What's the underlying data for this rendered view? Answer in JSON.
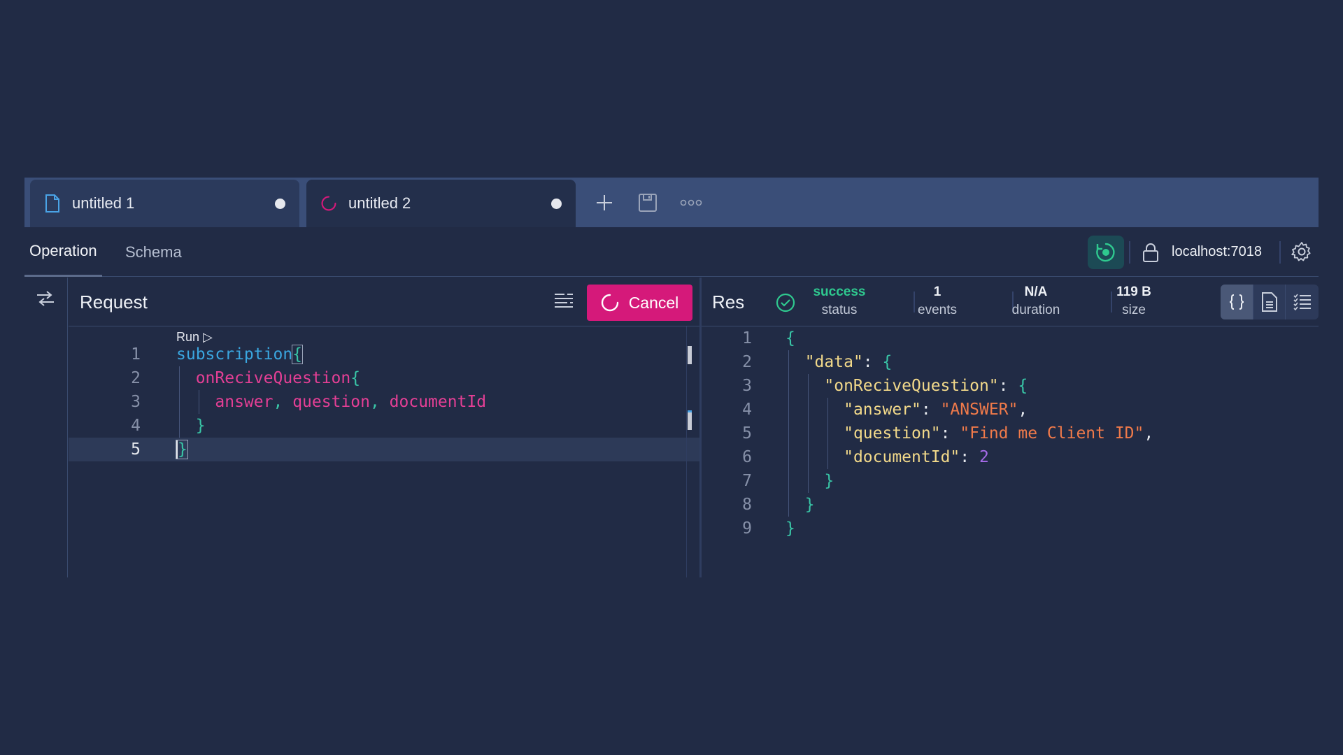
{
  "tabs": [
    {
      "label": "untitled 1",
      "icon": "file-icon",
      "unsaved": true,
      "active": false
    },
    {
      "label": "untitled 2",
      "icon": "loading-spinner-icon",
      "unsaved": true,
      "active": true
    }
  ],
  "subtabs": {
    "operation": "Operation",
    "schema": "Schema"
  },
  "connection": {
    "host": "localhost:7018"
  },
  "request": {
    "title": "Request",
    "cancel_label": "Cancel",
    "run_label": "Run ▷",
    "line_numbers": [
      "1",
      "2",
      "3",
      "4",
      "5"
    ],
    "lines": [
      [
        {
          "t": "subscription",
          "c": "kw"
        },
        {
          "t": "{",
          "c": "punc"
        }
      ],
      [
        {
          "t": "  onReciveQuestion",
          "c": "fld"
        },
        {
          "t": "{",
          "c": "punc"
        }
      ],
      [
        {
          "t": "    answer",
          "c": "fld"
        },
        {
          "t": ", ",
          "c": "punc"
        },
        {
          "t": "question",
          "c": "fld"
        },
        {
          "t": ", ",
          "c": "punc"
        },
        {
          "t": "documentId",
          "c": "fld"
        }
      ],
      [
        {
          "t": "  }",
          "c": "punc"
        }
      ],
      [
        {
          "t": "}",
          "c": "punc"
        }
      ]
    ]
  },
  "response": {
    "title": "Response",
    "status": {
      "value": "success",
      "label": "status"
    },
    "events": {
      "value": "1",
      "label": "events"
    },
    "duration": {
      "value": "N/A",
      "label": "duration"
    },
    "size": {
      "value": "119 B",
      "label": "size"
    },
    "line_numbers": [
      "1",
      "2",
      "3",
      "4",
      "5",
      "6",
      "7",
      "8",
      "9"
    ],
    "lines": [
      [
        {
          "t": "{",
          "c": "punc"
        }
      ],
      [
        {
          "t": "  ",
          "c": "plain"
        },
        {
          "t": "\"data\"",
          "c": "key"
        },
        {
          "t": ": ",
          "c": "plain"
        },
        {
          "t": "{",
          "c": "punc"
        }
      ],
      [
        {
          "t": "    ",
          "c": "plain"
        },
        {
          "t": "\"onReciveQuestion\"",
          "c": "key"
        },
        {
          "t": ": ",
          "c": "plain"
        },
        {
          "t": "{",
          "c": "punc"
        }
      ],
      [
        {
          "t": "      ",
          "c": "plain"
        },
        {
          "t": "\"answer\"",
          "c": "key"
        },
        {
          "t": ": ",
          "c": "plain"
        },
        {
          "t": "\"ANSWER\"",
          "c": "str"
        },
        {
          "t": ",",
          "c": "plain"
        }
      ],
      [
        {
          "t": "      ",
          "c": "plain"
        },
        {
          "t": "\"question\"",
          "c": "key"
        },
        {
          "t": ": ",
          "c": "plain"
        },
        {
          "t": "\"Find me Client ID\"",
          "c": "str"
        },
        {
          "t": ",",
          "c": "plain"
        }
      ],
      [
        {
          "t": "      ",
          "c": "plain"
        },
        {
          "t": "\"documentId\"",
          "c": "key"
        },
        {
          "t": ": ",
          "c": "plain"
        },
        {
          "t": "2",
          "c": "num"
        }
      ],
      [
        {
          "t": "    }",
          "c": "punc"
        }
      ],
      [
        {
          "t": "  }",
          "c": "punc"
        }
      ],
      [
        {
          "t": "}",
          "c": "punc"
        }
      ]
    ]
  },
  "colors": {
    "background": "#212b45",
    "accent": "#d5197a",
    "success": "#2fc98f"
  }
}
